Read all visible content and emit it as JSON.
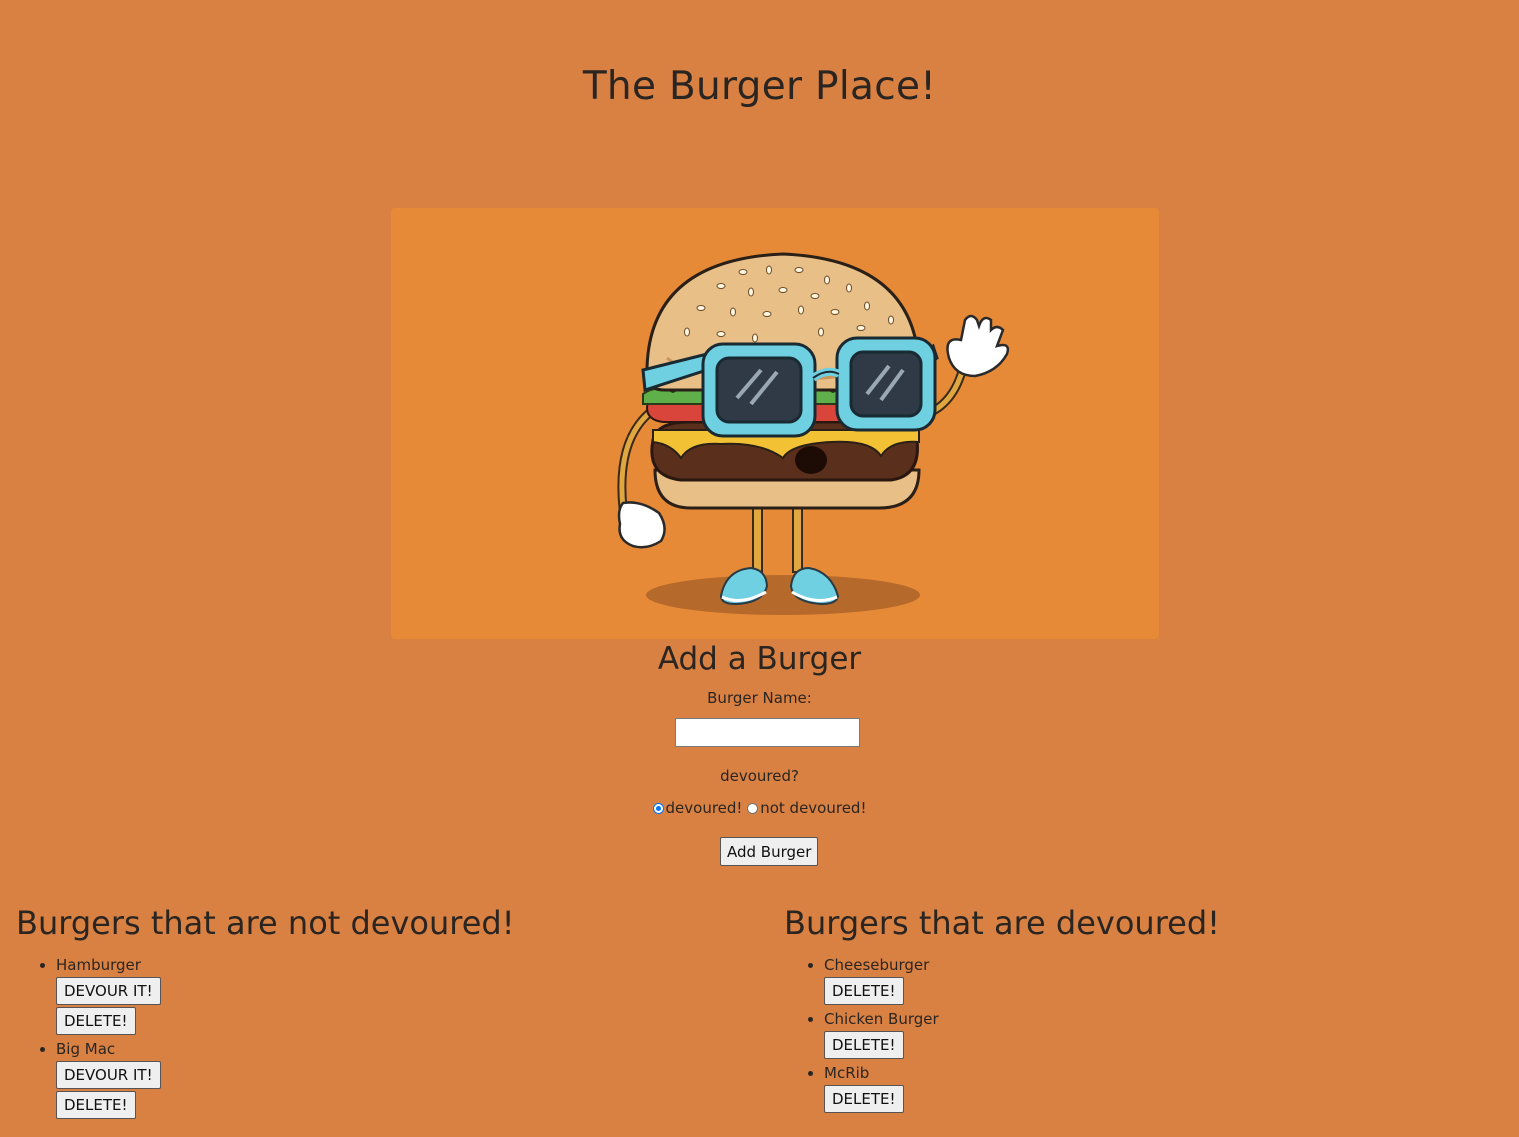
{
  "header": {
    "title": "The Burger Place!"
  },
  "form": {
    "title": "Add a Burger",
    "name_label": "Burger Name:",
    "name_value": "",
    "devoured_question": "devoured?",
    "radio_devoured": "devoured!",
    "radio_not_devoured": "not devoured!",
    "selected": "devoured!",
    "submit_label": "Add Burger"
  },
  "not_devoured": {
    "title": "Burgers that are not devoured!",
    "devour_label": "DEVOUR IT!",
    "delete_label": "DELETE!",
    "items": [
      "Hamburger",
      "Big Mac"
    ]
  },
  "devoured": {
    "title": "Burgers that are devoured!",
    "delete_label": "DELETE!",
    "items": [
      "Cheeseburger",
      "Chicken Burger",
      "McRib"
    ]
  },
  "colors": {
    "page_background": "#d98142",
    "hero_background": "#e68a38",
    "radio_accent": "#0075ff"
  }
}
